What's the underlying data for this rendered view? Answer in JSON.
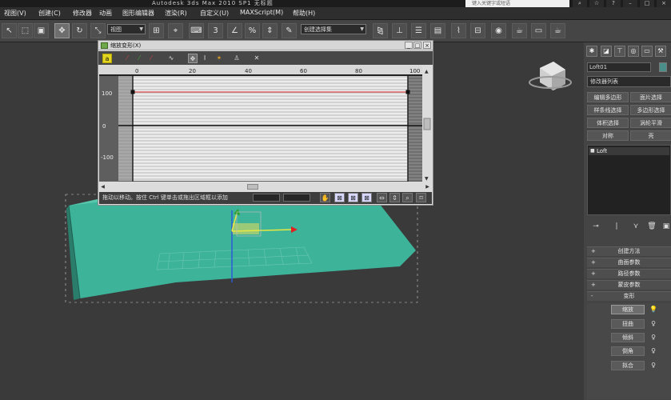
{
  "window": {
    "title": "Autodesk 3ds Max  2010 SP1    无标题",
    "search_placeholder": "键入关键字或短语"
  },
  "menubar": {
    "items": [
      "视图(V)",
      "创建(C)",
      "修改器",
      "动画",
      "图形编辑器",
      "渲染(R)",
      "自定义(U)",
      "MAXScript(M)",
      "帮助(H)"
    ]
  },
  "toolbar": {
    "view_dropdown": "视图",
    "selection_set_dropdown": "创建选择集"
  },
  "command_panel": {
    "object_name": "Loft01",
    "object_color": "#4a8f8a",
    "modifier_list": "修改器列表",
    "modifier_buttons": [
      "编辑多边形",
      "面片选择",
      "样条线选择",
      "多边形选择",
      "体积选择",
      "涡轮平滑",
      "对称",
      "壳"
    ],
    "stack_items": [
      "Loft"
    ],
    "rollouts": [
      {
        "sign": "+",
        "label": "创建方法"
      },
      {
        "sign": "+",
        "label": "曲面参数"
      },
      {
        "sign": "+",
        "label": "路径参数"
      },
      {
        "sign": "+",
        "label": "蒙皮参数"
      },
      {
        "sign": "-",
        "label": "变形"
      }
    ],
    "deform_buttons": [
      "缩放",
      "扭曲",
      "倾斜",
      "倒角",
      "拟合"
    ]
  },
  "scale_dialog": {
    "title": "缩放变形(X)",
    "ruler_ticks": [
      "0",
      "20",
      "40",
      "60",
      "80",
      "100"
    ],
    "y_labels": [
      "100",
      "0",
      "-100"
    ],
    "status_text": "拖动以移动。按住 Ctrl 键单击或拖出区域框以添加",
    "curve_color": "#e05050"
  }
}
